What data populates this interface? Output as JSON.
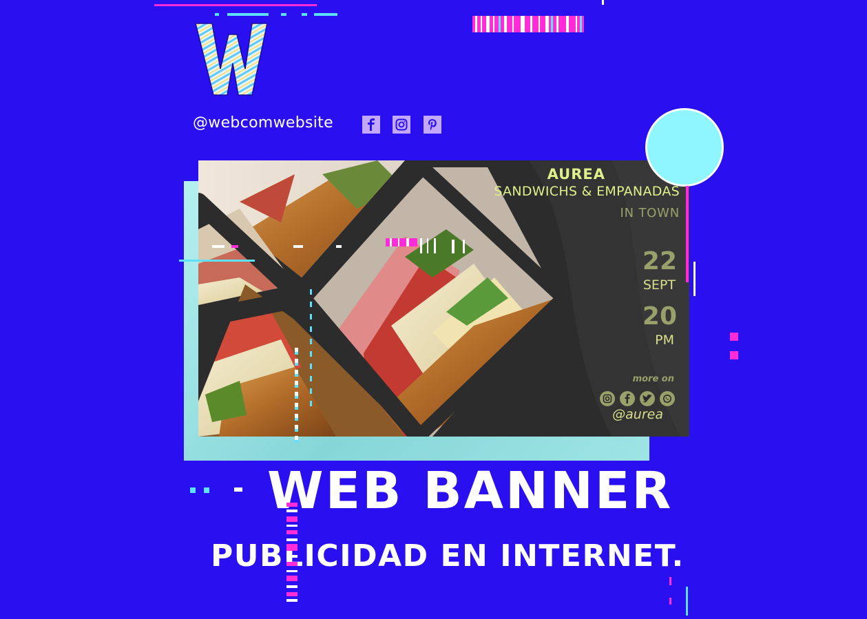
{
  "header": {
    "logo_letter": "W",
    "handle": "@webcomwebsite",
    "social_icons": [
      "facebook-icon",
      "instagram-icon",
      "pinterest-icon"
    ]
  },
  "banner": {
    "brand": "AUREA",
    "subtitle": "SANDWICHS & EMPANADAS",
    "tagline": "IN TOWN",
    "date_day": "22",
    "date_month": "SEPT",
    "time_hour": "20",
    "time_period": "PM",
    "more_on": "more on",
    "social_icons": [
      "instagram-icon",
      "facebook-icon",
      "twitter-icon",
      "whatsapp-icon"
    ],
    "handle": "@aurea"
  },
  "headline": {
    "title": "WEB BANNER",
    "subtitle": "PUBLICIDAD EN INTERNET."
  },
  "colors": {
    "background": "#2a10f0",
    "accent_magenta": "#ff2cd8",
    "accent_cyan": "#8ff6ff",
    "banner_dark": "#2c2c2c",
    "banner_text": "#dff08a"
  }
}
